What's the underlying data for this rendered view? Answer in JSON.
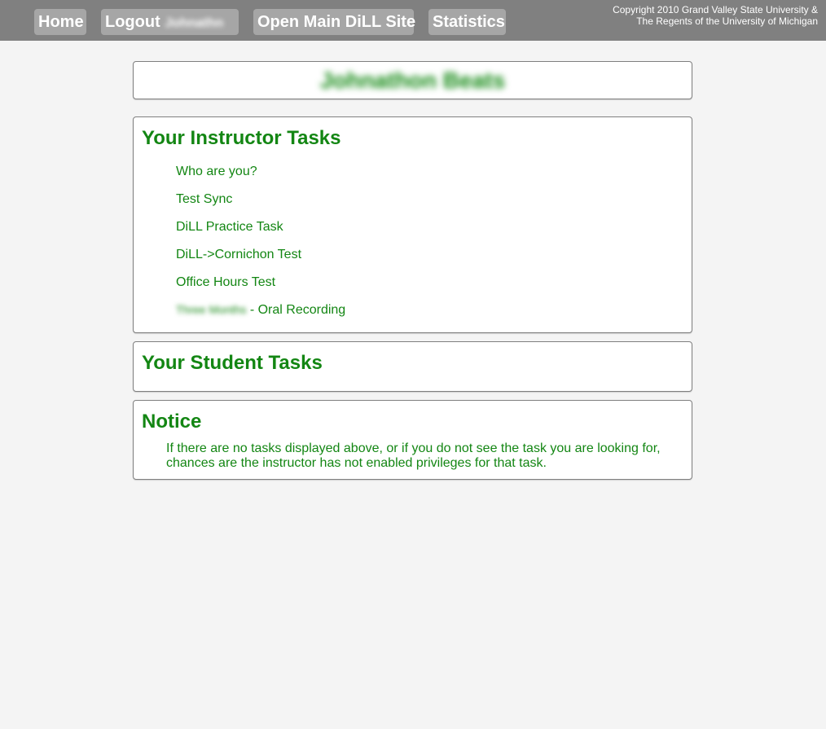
{
  "nav": {
    "home_label": "Home",
    "logout_label": "Logout",
    "logout_username": "Johnathn",
    "main_site_label": "Open Main DiLL Site",
    "statistics_label": "Statistics"
  },
  "copyright": {
    "line1": "Copyright 2010 Grand Valley State University &",
    "line2": "The Regents of the University of Michigan"
  },
  "user": {
    "display_name": "Johnathon Beats"
  },
  "instructor_tasks": {
    "title": "Your Instructor Tasks",
    "items": [
      {
        "label": "Who are you?"
      },
      {
        "label": "Test Sync"
      },
      {
        "label": "DiLL Practice Task"
      },
      {
        "label": "DiLL->Cornichon Test"
      },
      {
        "label": "Office Hours Test"
      },
      {
        "label_blurred": "Three Months",
        "label": " - Oral Recording"
      }
    ]
  },
  "student_tasks": {
    "title": "Your Student Tasks"
  },
  "notice": {
    "title": "Notice",
    "text": "If there are no tasks displayed above, or if you do not see the task you are looking for, chances are the instructor has not enabled privileges for that task."
  },
  "colors": {
    "topbar": "#808080",
    "button": "#a6a6a6",
    "accent_green": "#138613",
    "background": "#f4f4f4"
  }
}
